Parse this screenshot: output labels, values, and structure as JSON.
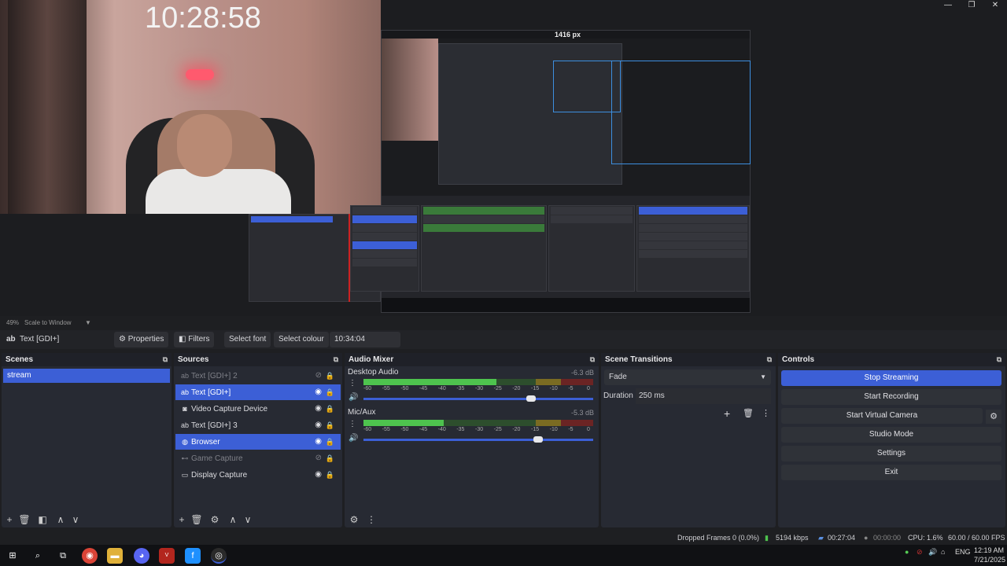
{
  "window": {
    "controls": [
      "—",
      "❐",
      "✕"
    ]
  },
  "preview": {
    "clock_overlay": "10:28:58",
    "nested_width_label": "1416 px",
    "zoom_level": "49%",
    "zoom_mode": "Scale to Window"
  },
  "property_bar": {
    "source_type_icon": "ab",
    "source_name": "Text [GDI+]",
    "properties_label": "Properties",
    "filters_label": "Filters",
    "select_font_label": "Select font",
    "select_colour_label": "Select colour",
    "text_value": "10:34:04"
  },
  "scenes": {
    "title": "Scenes",
    "items": [
      "stream"
    ]
  },
  "sources": {
    "title": "Sources",
    "items": [
      {
        "icon": "ab",
        "label": "Text [GDI+] 2",
        "state": "hidden"
      },
      {
        "icon": "ab",
        "label": "Text [GDI+]",
        "state": "selected"
      },
      {
        "icon": "camera",
        "label": "Video Capture Device",
        "state": "visible"
      },
      {
        "icon": "ab",
        "label": "Text [GDI+] 3",
        "state": "visible"
      },
      {
        "icon": "globe",
        "label": "Browser",
        "state": "selected"
      },
      {
        "icon": "gamepad",
        "label": "Game Capture",
        "state": "hidden"
      },
      {
        "icon": "monitor",
        "label": "Display Capture",
        "state": "visible"
      }
    ]
  },
  "audio_mixer": {
    "title": "Audio Mixer",
    "channels": [
      {
        "name": "Desktop Audio",
        "db": "-6.3 dB",
        "level": 0.58,
        "volume": 0.73
      },
      {
        "name": "Mic/Aux",
        "db": "-5.3 dB",
        "level": 0.35,
        "volume": 0.76
      }
    ],
    "scale": [
      "-60",
      "-55",
      "-50",
      "-45",
      "-40",
      "-35",
      "-30",
      "-25",
      "-20",
      "-15",
      "-10",
      "-5",
      "0"
    ]
  },
  "scene_transitions": {
    "title": "Scene Transitions",
    "transition": "Fade",
    "duration_label": "Duration",
    "duration_value": "250 ms"
  },
  "controls": {
    "title": "Controls",
    "buttons": [
      "Stop Streaming",
      "Start Recording",
      "Start Virtual Camera",
      "Studio Mode",
      "Settings",
      "Exit"
    ]
  },
  "status": {
    "dropped_frames": "Dropped Frames 0 (0.0%)",
    "bitrate": "5194 kbps",
    "stream_time": "00:27:04",
    "record_time": "00:00:00",
    "cpu": "CPU: 1.6%",
    "fps": "60.00 / 60.00 FPS"
  },
  "taskbar": {
    "language": "ENG",
    "time": "12:19 AM",
    "date": "7/21/2025"
  },
  "colors": {
    "accent": "#3c5fd6",
    "dock_bg": "#272a33",
    "meter_green": "#4ec34e"
  }
}
